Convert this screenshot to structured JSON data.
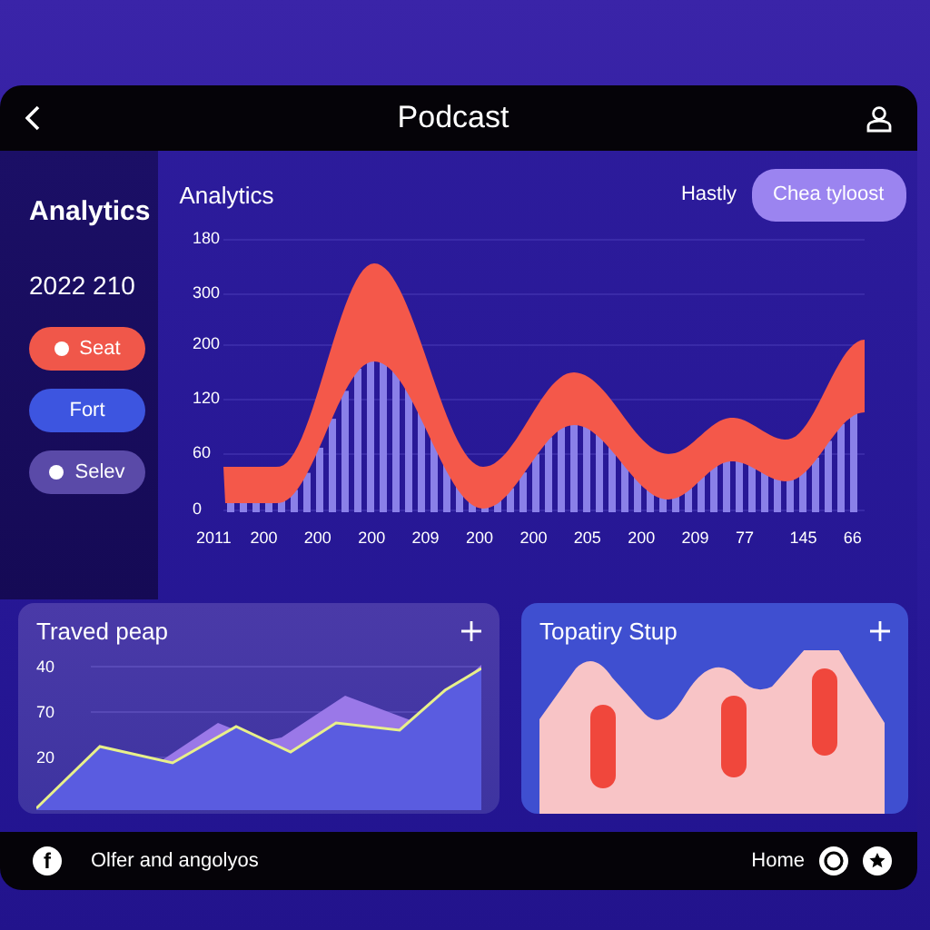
{
  "header": {
    "title": "Podcast"
  },
  "sidebar": {
    "title": "Analytics",
    "subtitle": "2022 210",
    "pills": [
      {
        "label": "Seat",
        "color": "#f0574a",
        "dot": true
      },
      {
        "label": "Fort",
        "color": "#3d55e0",
        "dot": false
      },
      {
        "label": "Selev",
        "color": "#5a4aa8",
        "dot": true
      }
    ]
  },
  "main_chart": {
    "title": "Analytics",
    "filter_label": "Hastly",
    "button": "Chea tyloost",
    "y_labels": [
      "180",
      "300",
      "200",
      "120",
      "60",
      "0"
    ],
    "x_labels": [
      "2011",
      "200",
      "200",
      "200",
      "209",
      "200",
      "200",
      "205",
      "200",
      "209",
      "77",
      "145",
      "66"
    ]
  },
  "cards": [
    {
      "title": "Traved peap",
      "kind": "area",
      "y_labels": [
        "40",
        "70",
        "20"
      ]
    },
    {
      "title": "Topatiry Stup",
      "kind": "mountain"
    }
  ],
  "footer": {
    "logo": "f",
    "text": "Olfer and angolyos",
    "home": "Home"
  }
}
